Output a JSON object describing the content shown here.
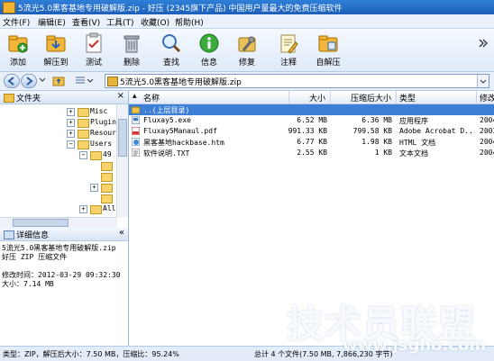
{
  "window": {
    "title": "5流光5.0黑客基地专用破解版.zip - 好压 (2345旗下产品) 中国用户量最大的免费压缩软件"
  },
  "menu": [
    "文件(F)",
    "编辑(E)",
    "查看(V)",
    "工具(T)",
    "收藏(O)",
    "帮助(H)"
  ],
  "toolbar": [
    "添加",
    "解压到",
    "测试",
    "删除",
    "查找",
    "信息",
    "修复",
    "注释",
    "自解压"
  ],
  "address": {
    "path": "5流光5.0黑客基地专用破解版.zip"
  },
  "folder_pane": {
    "title": "文件夹",
    "nodes": [
      "Misc",
      "Plugin",
      "Resour",
      "Users",
      "49",
      "All"
    ]
  },
  "detail_pane": {
    "title": "详细信息",
    "name": "5流光5.0黑客基地专用破解版.zip",
    "type": "好压 ZIP 压缩文件",
    "modified": "修改时间：2012-03-29 09:32:30",
    "size": "大小：7.14 MB"
  },
  "columns": [
    "名称",
    "大小",
    "压缩后大小",
    "类型",
    "修改"
  ],
  "files": [
    {
      "name": "..(上层目录)",
      "size": "",
      "packed": "",
      "type": "",
      "date": "",
      "icon": "folder-up-icon"
    },
    {
      "name": "Fluxay5.exe",
      "size": "6.52 MB",
      "packed": "6.36 MB",
      "type": "应用程序",
      "date": "2004",
      "icon": "exe-icon"
    },
    {
      "name": "Fluxay5Manaul.pdf",
      "size": "991.33 KB",
      "packed": "799.58 KB",
      "type": "Adobe Acrobat D...",
      "date": "2003",
      "icon": "pdf-icon"
    },
    {
      "name": "黑客基地hackbase.htm",
      "size": "6.77 KB",
      "packed": "1.98 KB",
      "type": "HTML 文档",
      "date": "2004",
      "icon": "html-icon"
    },
    {
      "name": "软件说明.TXT",
      "size": "2.55 KB",
      "packed": "1 KB",
      "type": "文本文档",
      "date": "2004",
      "icon": "txt-icon"
    }
  ],
  "status": {
    "left": "类型：ZIP，解压后大小：7.50 MB，压缩比：95.24%",
    "right": "总计 4 个文件(7.50 MB, 7,866,230 字节)"
  },
  "watermark": {
    "brand": "技术员联盟",
    "url": "www.jsgho.com"
  },
  "colors": {
    "title_bar": "#1d5fb8",
    "selection": "#3d7fd6",
    "accent": "#f3b431"
  }
}
